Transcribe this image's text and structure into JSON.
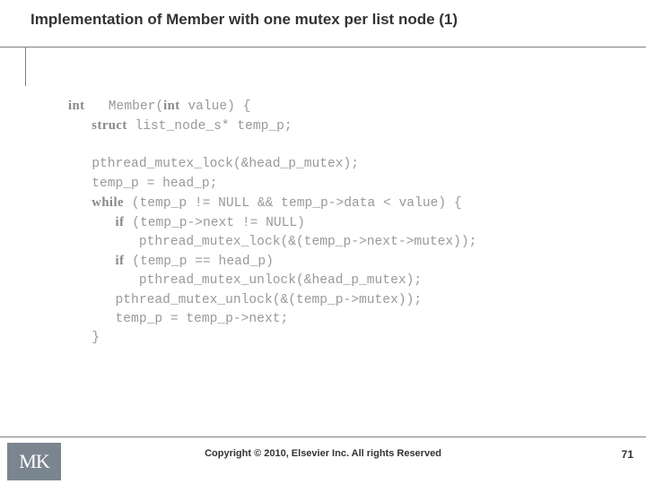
{
  "slide": {
    "title": "Implementation of Member with one mutex per list node (1)",
    "copyright": "Copyright © 2010, Elsevier Inc. All rights Reserved",
    "page_number": "71",
    "logo": "MK"
  },
  "code": {
    "line1_kw": "int",
    "line1_rest": "   Member(",
    "line1_kw2": "int",
    "line1_rest2": " value) {",
    "line2_indent": "   ",
    "line2_kw": "struct",
    "line2_rest": " list_node_s* temp_p;",
    "line3": "",
    "line4": "   pthread_mutex_lock(&head_p_mutex);",
    "line5": "   temp_p = head_p;",
    "line6_indent": "   ",
    "line6_kw": "while",
    "line6_rest": " (temp_p != NULL && temp_p->data < value) {",
    "line7_indent": "      ",
    "line7_kw": "if",
    "line7_rest": " (temp_p->next != NULL)",
    "line8": "         pthread_mutex_lock(&(temp_p->next->mutex));",
    "line9_indent": "      ",
    "line9_kw": "if",
    "line9_rest": " (temp_p == head_p)",
    "line10": "         pthread_mutex_unlock(&head_p_mutex);",
    "line11": "      pthread_mutex_unlock(&(temp_p->mutex));",
    "line12": "      temp_p = temp_p->next;",
    "line13": "   }"
  }
}
